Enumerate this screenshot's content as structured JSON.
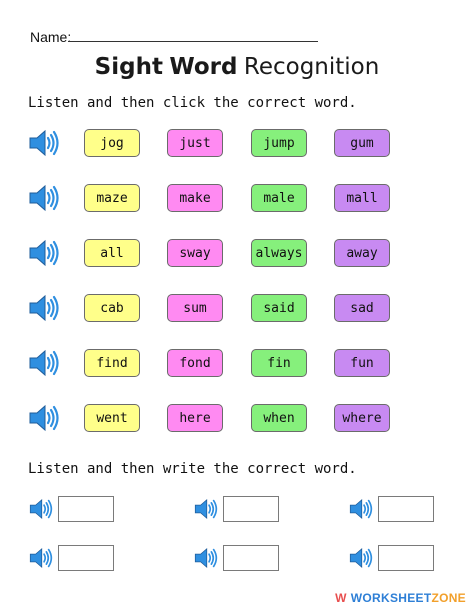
{
  "header": {
    "name_label": "Name:",
    "title_part1": "Sight",
    "title_part2": "Word",
    "title_part3": "Recognition"
  },
  "section1": {
    "instruction": "Listen and then click the correct word."
  },
  "section2": {
    "instruction": "Listen and then write the correct word."
  },
  "word_colors": [
    "#ffff8a",
    "#ff8af2",
    "#86f07c",
    "#c88af2"
  ],
  "word_rows": [
    [
      "jog",
      "just",
      "jump",
      "gum"
    ],
    [
      "maze",
      "make",
      "male",
      "mall"
    ],
    [
      "all",
      "sway",
      "always",
      "away"
    ],
    [
      "cab",
      "sum",
      "said",
      "sad"
    ],
    [
      "find",
      "fond",
      "fin",
      "fun"
    ],
    [
      "went",
      "here",
      "when",
      "where"
    ]
  ],
  "speaker_color": "#2f8fe0",
  "watermark": {
    "logo": "W",
    "text1": "WORKSHEET",
    "text2": "ZONE"
  }
}
